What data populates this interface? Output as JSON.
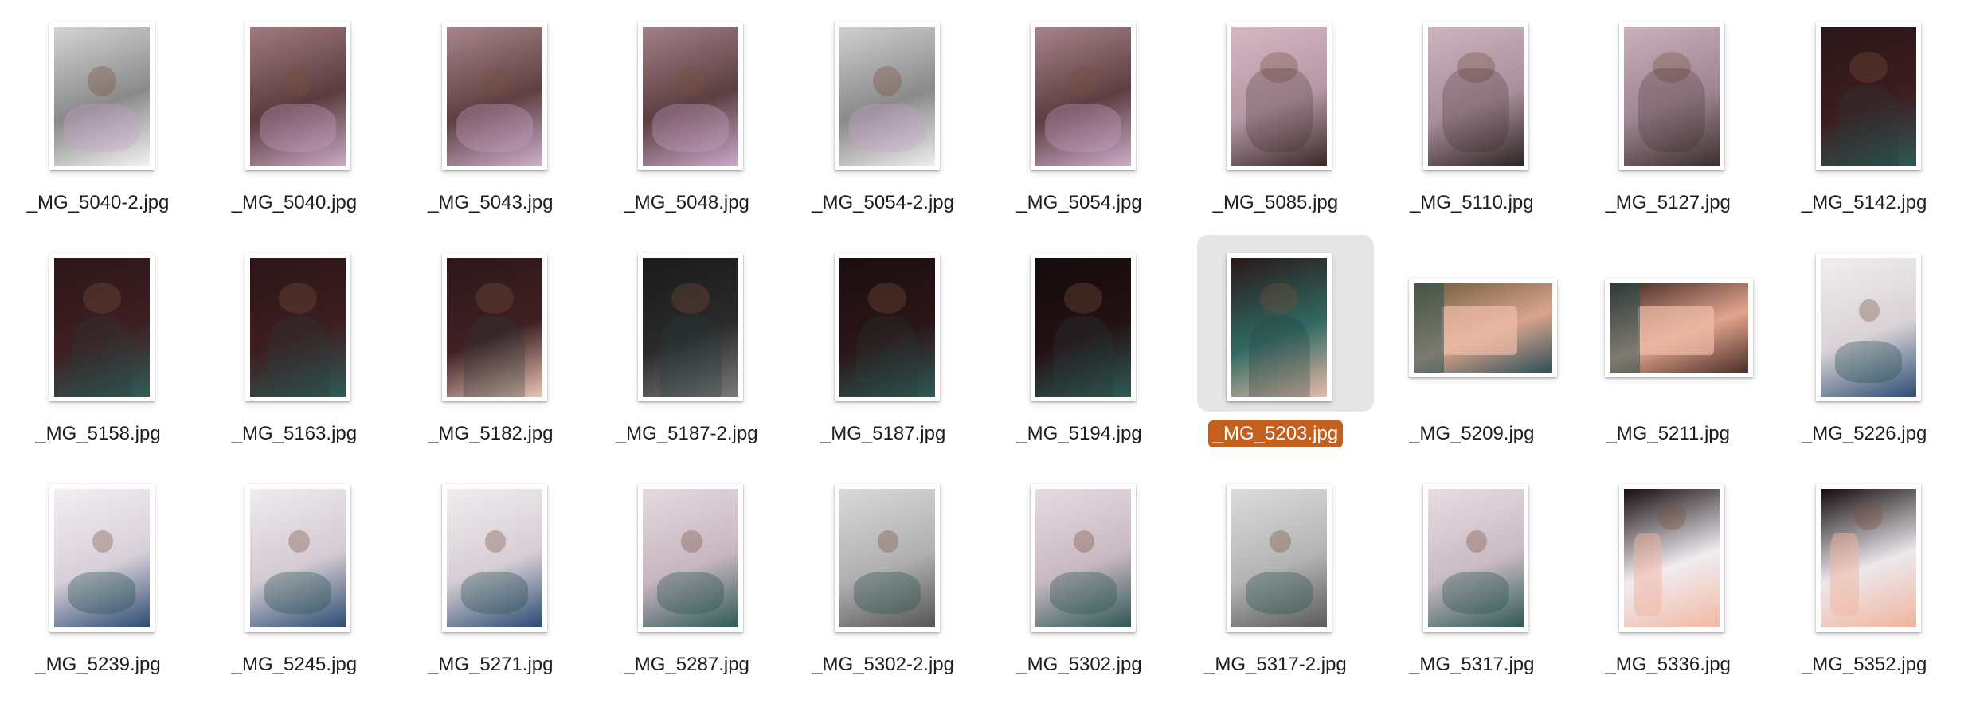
{
  "colors": {
    "selection_highlight": "#c45f1e",
    "selection_background": "#e6e6e6",
    "label_text": "#1d1d1f"
  },
  "files": [
    {
      "name": "_MG_5040-2.jpg",
      "orientation": "portrait",
      "tone": "bed",
      "colors": [
        "#d4d4d4",
        "#8a8a8a",
        "#f2f2f2"
      ],
      "selected": false
    },
    {
      "name": "_MG_5040.jpg",
      "orientation": "portrait",
      "tone": "bed",
      "colors": [
        "#a07a80",
        "#5a3c3e",
        "#c9a8c4"
      ],
      "selected": false
    },
    {
      "name": "_MG_5043.jpg",
      "orientation": "portrait",
      "tone": "bed",
      "colors": [
        "#a8848a",
        "#5e4042",
        "#cdaecb"
      ],
      "selected": false
    },
    {
      "name": "_MG_5048.jpg",
      "orientation": "portrait",
      "tone": "bed",
      "colors": [
        "#a27f86",
        "#5c3f42",
        "#c8a8c8"
      ],
      "selected": false
    },
    {
      "name": "_MG_5054-2.jpg",
      "orientation": "portrait",
      "tone": "bed",
      "colors": [
        "#cfcfcf",
        "#8a8a8a",
        "#ededed"
      ],
      "selected": false
    },
    {
      "name": "_MG_5054.jpg",
      "orientation": "portrait",
      "tone": "bed",
      "colors": [
        "#a7838a",
        "#5d3e41",
        "#ccacc9"
      ],
      "selected": false
    },
    {
      "name": "_MG_5085.jpg",
      "orientation": "portrait",
      "tone": "top",
      "colors": [
        "#d6b8c3",
        "#b497a4",
        "#3a2a28"
      ],
      "selected": false
    },
    {
      "name": "_MG_5110.jpg",
      "orientation": "portrait",
      "tone": "top",
      "colors": [
        "#cdb3be",
        "#a98f9c",
        "#2f2624"
      ],
      "selected": false
    },
    {
      "name": "_MG_5127.jpg",
      "orientation": "portrait",
      "tone": "top",
      "colors": [
        "#c9b0bb",
        "#9e8592",
        "#3b302d"
      ],
      "selected": false
    },
    {
      "name": "_MG_5142.jpg",
      "orientation": "portrait",
      "tone": "dark",
      "colors": [
        "#2a1618",
        "#3c1d20",
        "#2d5a55"
      ],
      "selected": false
    },
    {
      "name": "_MG_5158.jpg",
      "orientation": "portrait",
      "tone": "dark",
      "colors": [
        "#2c1719",
        "#3e1e21",
        "#2f5e58"
      ],
      "selected": false
    },
    {
      "name": "_MG_5163.jpg",
      "orientation": "portrait",
      "tone": "dark",
      "colors": [
        "#2b1618",
        "#3d1d20",
        "#2e5c56"
      ],
      "selected": false
    },
    {
      "name": "_MG_5182.jpg",
      "orientation": "portrait",
      "tone": "dark",
      "colors": [
        "#2d181a",
        "#3f1f22",
        "#e9c3b4"
      ],
      "selected": false
    },
    {
      "name": "_MG_5187-2.jpg",
      "orientation": "portrait",
      "tone": "dark",
      "colors": [
        "#1a1a1a",
        "#2a2a2a",
        "#7a7a7a"
      ],
      "selected": false
    },
    {
      "name": "_MG_5187.jpg",
      "orientation": "portrait",
      "tone": "dark",
      "colors": [
        "#1c0f10",
        "#2a1416",
        "#2e5b56"
      ],
      "selected": false
    },
    {
      "name": "_MG_5194.jpg",
      "orientation": "portrait",
      "tone": "dark",
      "colors": [
        "#150b0c",
        "#231113",
        "#2e5c57"
      ],
      "selected": false
    },
    {
      "name": "_MG_5203.jpg",
      "orientation": "portrait",
      "tone": "dark",
      "colors": [
        "#2a1719",
        "#2f6a62",
        "#e8b9a6"
      ],
      "selected": true
    },
    {
      "name": "_MG_5209.jpg",
      "orientation": "landscape",
      "tone": "notebook",
      "colors": [
        "#6c5a3a",
        "#d9a48f",
        "#2c5055"
      ],
      "selected": false
    },
    {
      "name": "_MG_5211.jpg",
      "orientation": "landscape",
      "tone": "notebook",
      "colors": [
        "#3b2420",
        "#e2a58e",
        "#4a2e28"
      ],
      "selected": false
    },
    {
      "name": "_MG_5226.jpg",
      "orientation": "portrait",
      "tone": "white",
      "colors": [
        "#f1eef0",
        "#d9d2d6",
        "#2c4e75"
      ],
      "selected": false
    },
    {
      "name": "_MG_5239.jpg",
      "orientation": "portrait",
      "tone": "white",
      "colors": [
        "#f2eef2",
        "#d8d0d8",
        "#2a4b74"
      ],
      "selected": false
    },
    {
      "name": "_MG_5245.jpg",
      "orientation": "portrait",
      "tone": "white",
      "colors": [
        "#efebee",
        "#d3cbd1",
        "#2b4c75"
      ],
      "selected": false
    },
    {
      "name": "_MG_5271.jpg",
      "orientation": "portrait",
      "tone": "white",
      "colors": [
        "#f0ecef",
        "#d6ced4",
        "#2a4a73"
      ],
      "selected": false
    },
    {
      "name": "_MG_5287.jpg",
      "orientation": "portrait",
      "tone": "white",
      "colors": [
        "#e6d9e0",
        "#c7b6c0",
        "#2d5a55"
      ],
      "selected": false
    },
    {
      "name": "_MG_5302-2.jpg",
      "orientation": "portrait",
      "tone": "white",
      "colors": [
        "#d9d9d9",
        "#b0b0b0",
        "#555555"
      ],
      "selected": false
    },
    {
      "name": "_MG_5302.jpg",
      "orientation": "portrait",
      "tone": "white",
      "colors": [
        "#e7dbe2",
        "#c8b8c2",
        "#2c5853"
      ],
      "selected": false
    },
    {
      "name": "_MG_5317-2.jpg",
      "orientation": "portrait",
      "tone": "white",
      "colors": [
        "#dcdcdc",
        "#b4b4b4",
        "#5a5a5a"
      ],
      "selected": false
    },
    {
      "name": "_MG_5317.jpg",
      "orientation": "portrait",
      "tone": "white",
      "colors": [
        "#e8dde3",
        "#c9bac3",
        "#2d5954"
      ],
      "selected": false
    },
    {
      "name": "_MG_5336.jpg",
      "orientation": "portrait",
      "tone": "wall",
      "colors": [
        "#150d10",
        "#f0ecf0",
        "#f2b9a2"
      ],
      "selected": false
    },
    {
      "name": "_MG_5352.jpg",
      "orientation": "portrait",
      "tone": "wall",
      "colors": [
        "#120b0d",
        "#ece8ec",
        "#f0b49c"
      ],
      "selected": false
    }
  ]
}
